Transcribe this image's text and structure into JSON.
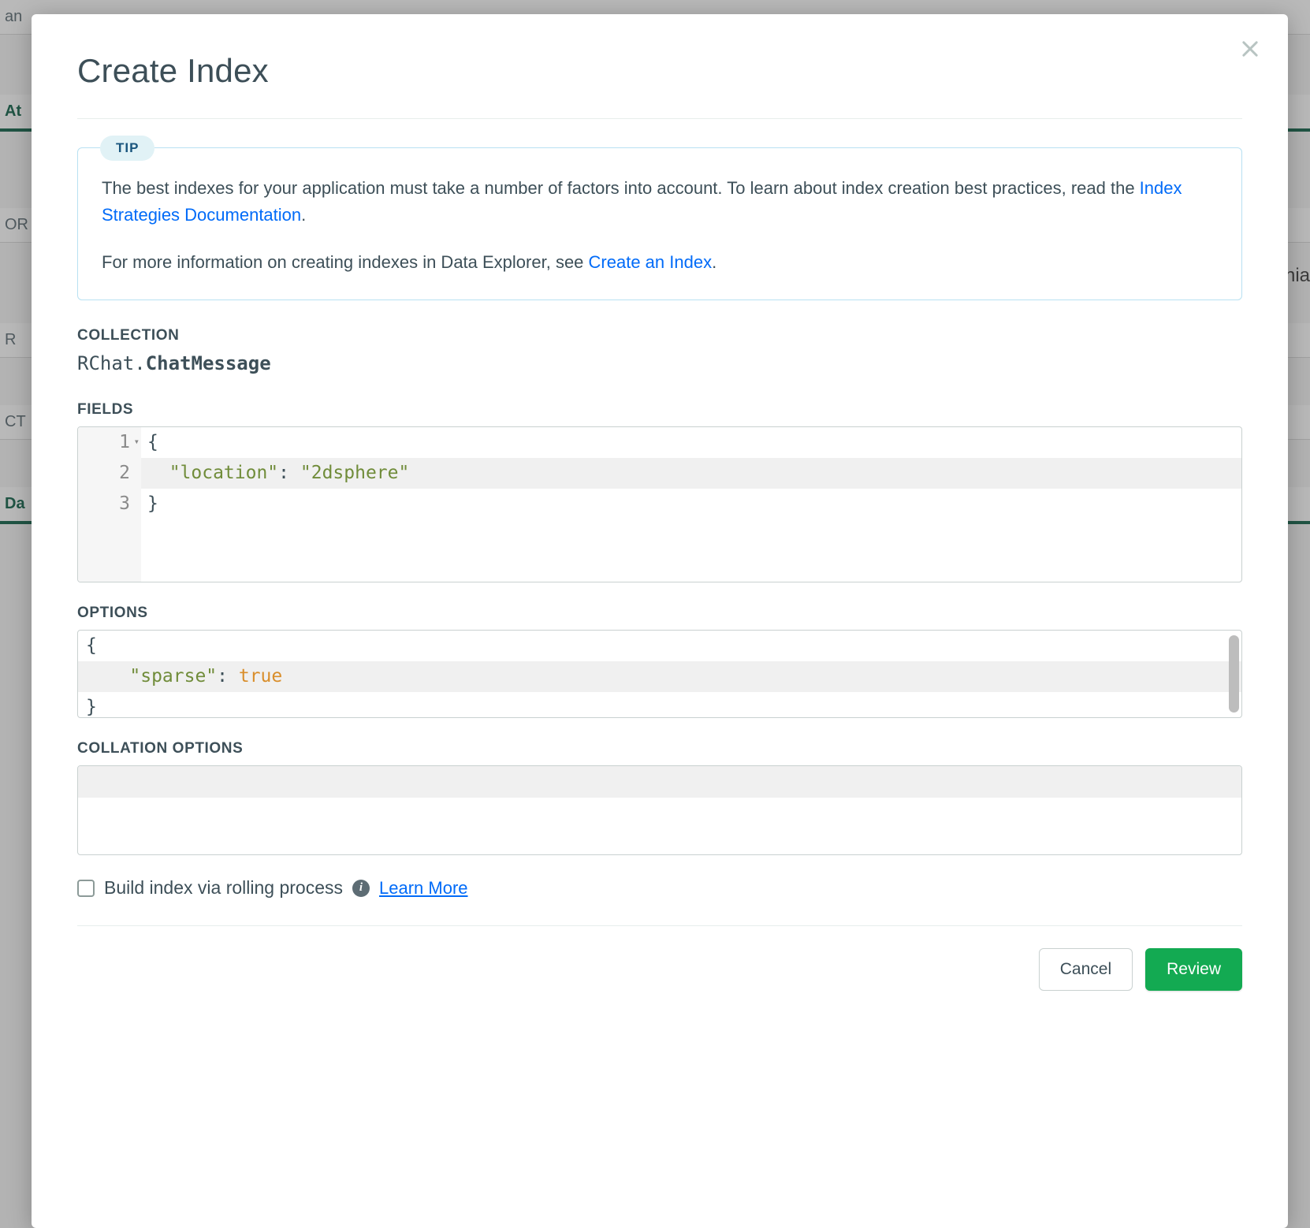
{
  "background": {
    "left_items": [
      "an",
      "At",
      "OR",
      "R",
      "CT",
      "Da"
    ],
    "right_text": "nia"
  },
  "modal": {
    "title": "Create Index",
    "close_label": "Close"
  },
  "tip": {
    "badge": "TIP",
    "p1_before": "The best indexes for your application must take a number of factors into account. To learn about index creation best practices, read the ",
    "p1_link": "Index Strategies Documentation",
    "p1_after": ".",
    "p2_before": "For more information on creating indexes in Data Explorer, see ",
    "p2_link": "Create an Index",
    "p2_after": "."
  },
  "collection": {
    "label": "COLLECTION",
    "db": "RChat",
    "sep": ".",
    "name": "ChatMessage"
  },
  "fields": {
    "label": "FIELDS",
    "lines": {
      "num1": "1",
      "num2": "2",
      "num3": "3",
      "l1": "{",
      "l2_key": "\"location\"",
      "l2_colon": ": ",
      "l2_val": "\"2dsphere\"",
      "l3": "}"
    }
  },
  "options": {
    "label": "OPTIONS",
    "lines": {
      "l1": "{",
      "l2_key": "\"sparse\"",
      "l2_colon": ": ",
      "l2_val": "true",
      "l3": "}"
    }
  },
  "collation": {
    "label": "COLLATION OPTIONS"
  },
  "rolling": {
    "label": "Build index via rolling process",
    "learn_more": "Learn More",
    "checked": false
  },
  "footer": {
    "cancel": "Cancel",
    "review": "Review"
  }
}
